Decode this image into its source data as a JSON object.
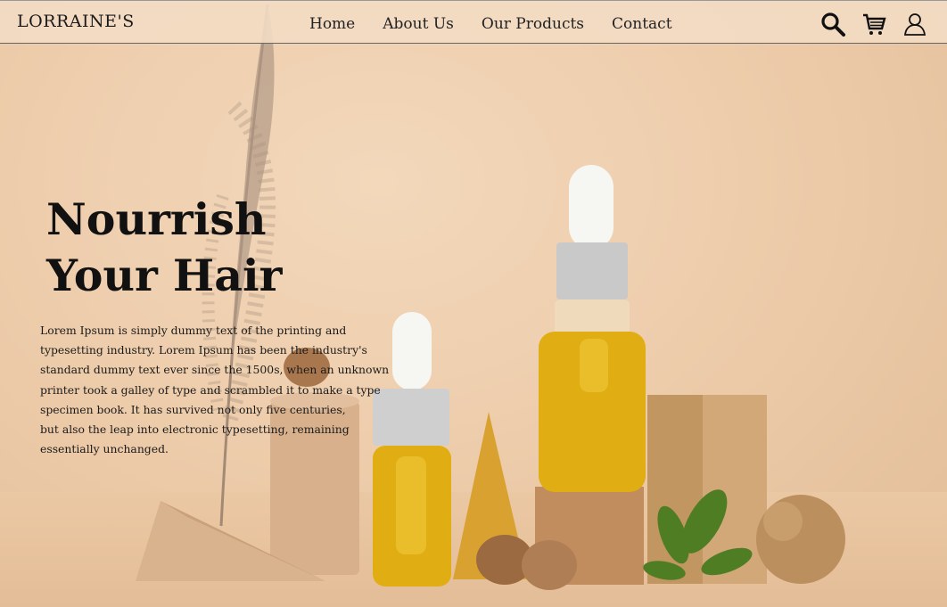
{
  "brand": {
    "logo": "LORRAINE'S"
  },
  "nav": {
    "items": [
      "Home",
      "About Us",
      "Our Products",
      "Contact"
    ]
  },
  "header_icons": [
    "search-icon",
    "cart-icon",
    "user-icon"
  ],
  "hero": {
    "title_line1": "Nourrish",
    "title_line2": "Your Hair",
    "body_lines": [
      "Lorem Ipsum is simply dummy text of the printing and",
      " typesetting industry. Lorem Ipsum has been the industry's",
      " standard dummy text ever since the 1500s, when an unknown",
      " printer took a galley of type and scrambled it to make a type",
      "specimen book. It has survived not only five centuries,",
      " but also the leap into electronic typesetting, remaining",
      "essentially unchanged."
    ]
  },
  "colors": {
    "background": "#eccaa8",
    "oil": "#e0ad12",
    "wood": "#c99a6c",
    "text": "#111111"
  }
}
